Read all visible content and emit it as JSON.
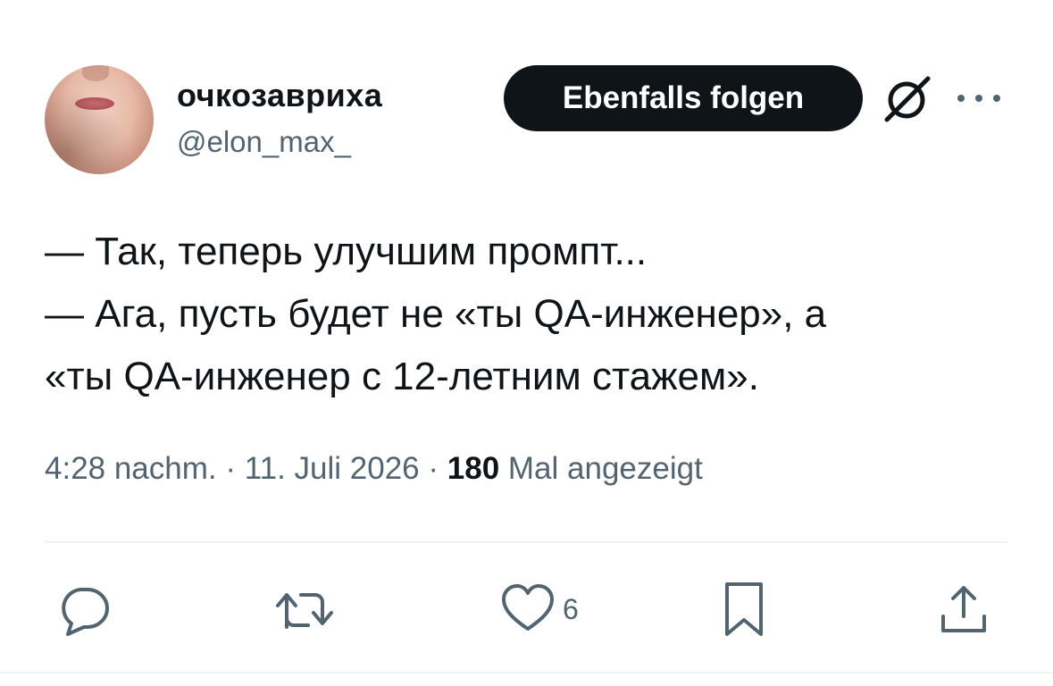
{
  "author": {
    "display_name": "очкозавриха",
    "handle": "@elon_max_"
  },
  "follow_button_label": "Ebenfalls folgen",
  "tweet": {
    "lines": [
      "— Так, теперь улучшим промпт...",
      "— Ага, пусть будет не «ты QA-инженер», а",
      "«ты QA-инженер с 12-летним стажем»."
    ]
  },
  "meta": {
    "time": "4:28 nachm.",
    "separator": "·",
    "date": "11. Juli 2026",
    "views_count": "180",
    "views_label": "Mal angezeigt"
  },
  "actions": {
    "like_count": "6"
  },
  "icons": {
    "grok": "grok-icon",
    "more": "more-icon",
    "reply": "reply-icon",
    "retweet": "retweet-icon",
    "like": "heart-icon",
    "bookmark": "bookmark-icon",
    "share": "share-icon"
  },
  "colors": {
    "text_primary": "#0f1419",
    "text_secondary": "#536471",
    "button_bg": "#0f1419",
    "divider": "#eff3f4"
  }
}
